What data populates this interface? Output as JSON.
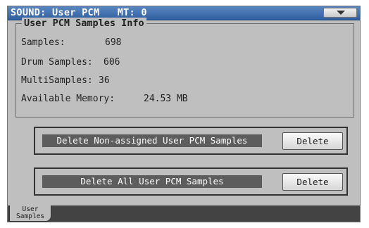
{
  "header": {
    "title": "SOUND: User PCM   MT: 0",
    "menu_icon": "chevron-down-icon"
  },
  "info": {
    "title": "User PCM Samples Info",
    "samples_label": "Samples:",
    "samples_value": "698",
    "drum_label": "Drum Samples:",
    "drum_value": "606",
    "multi_label": "MultiSamples:",
    "multi_value": "36",
    "memory_label": "Available Memory:",
    "memory_value": "24.53 MB"
  },
  "actions": [
    {
      "label": "Delete Non-assigned User PCM Samples",
      "button": "Delete"
    },
    {
      "label": "Delete All User PCM Samples",
      "button": "Delete"
    }
  ],
  "tabs": [
    {
      "line1": "User",
      "line2": "Samples"
    }
  ]
}
